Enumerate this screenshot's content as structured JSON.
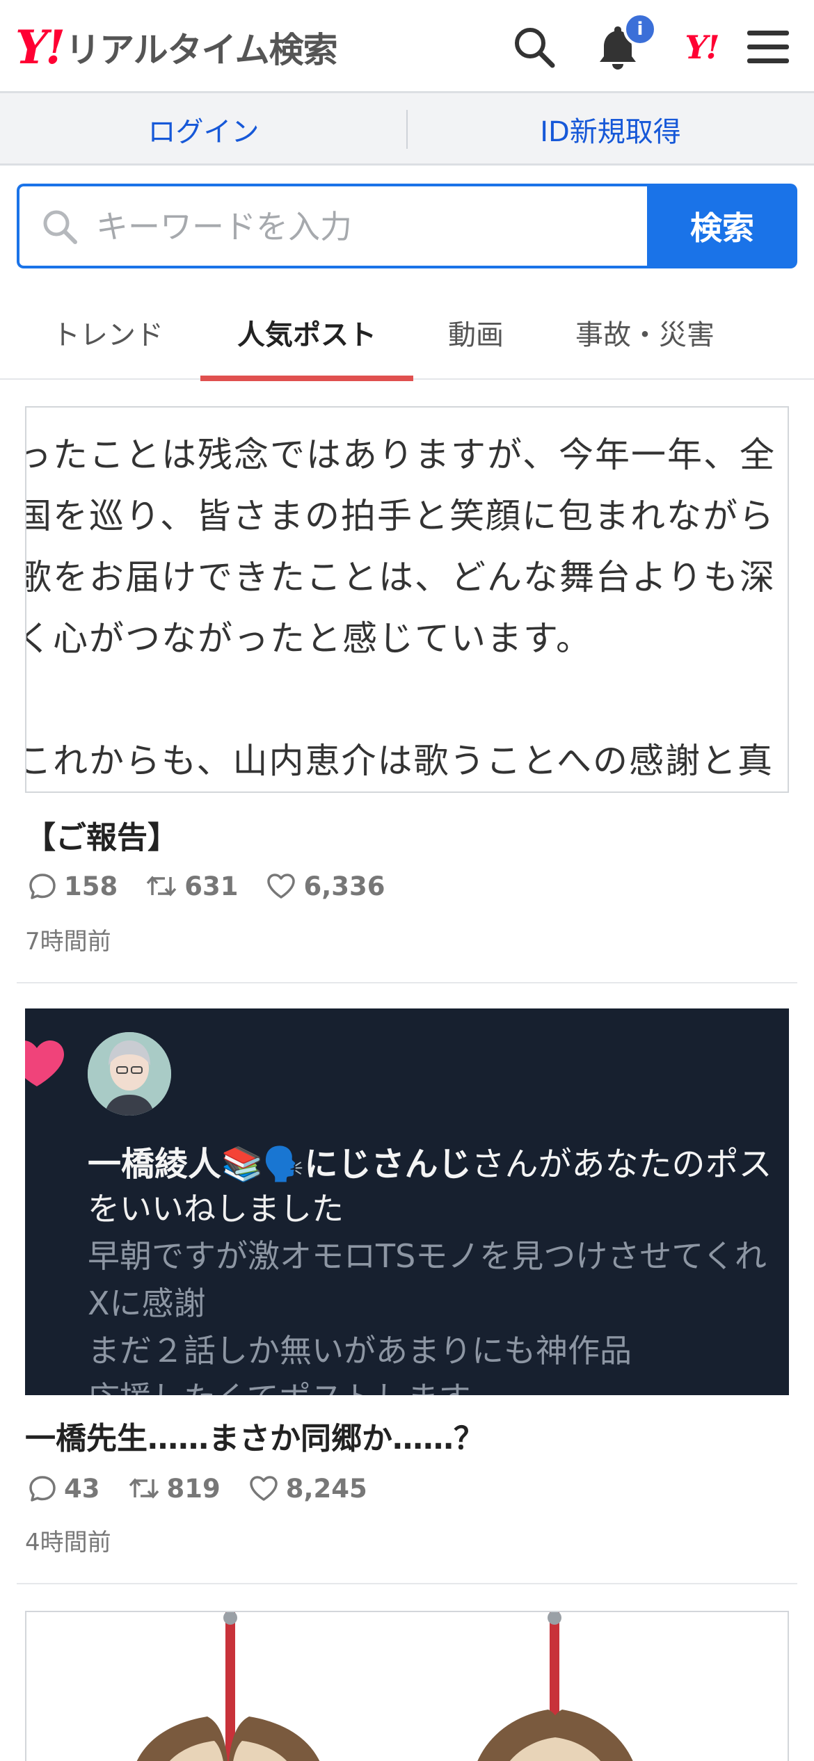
{
  "header": {
    "logo_mark": "Y!",
    "logo_text": "リアルタイム検索",
    "notification_badge": "i",
    "yj_mark": "Y!"
  },
  "account": {
    "login_label": "ログイン",
    "register_label": "ID新規取得"
  },
  "search": {
    "placeholder": "キーワードを入力",
    "value": "",
    "submit_label": "検索"
  },
  "tabs": [
    {
      "label": "トレンド",
      "active": false
    },
    {
      "label": "人気ポスト",
      "active": true
    },
    {
      "label": "動画",
      "active": false
    },
    {
      "label": "事故・災害",
      "active": false
    }
  ],
  "posts": [
    {
      "image_text": [
        "ったことは残念ではありますが、今年一年、全",
        "国を巡り、皆さまの拍手と笑顔に包まれながら",
        "歌をお届けできたことは、どんな舞台よりも深",
        "く心がつながったと感じています。",
        "",
        "これからも、山内恵介は歌うことへの感謝と真"
      ],
      "title": "【ご報告】",
      "replies": "158",
      "reposts": "631",
      "likes": "6,336",
      "time": "7時間前"
    },
    {
      "image_text": {
        "name": "一橋綾人📚🗣️にじさんじ",
        "name_rest": "さんがあなたのポス",
        "line2": "をいいねしました",
        "dim_lines": [
          "早朝ですが激オモロTSモノを見つけさせてくれ",
          "Xに感謝",
          "まだ２話しか無いがあまりにも神作品",
          "応援したくてポストします"
        ]
      },
      "title": "一橋先生……まさか同郷か……？",
      "replies": "43",
      "reposts": "819",
      "likes": "8,245",
      "time": "4時間前"
    }
  ],
  "colors": {
    "brand_red": "#ff0033",
    "link_blue": "#1658d8",
    "search_blue": "#1a73e8",
    "tab_underline": "#e0504f",
    "badge_blue": "#3b6fd8"
  },
  "icons": [
    "search-icon",
    "bell-icon",
    "menu-icon",
    "reply-icon",
    "repost-icon",
    "like-icon"
  ]
}
